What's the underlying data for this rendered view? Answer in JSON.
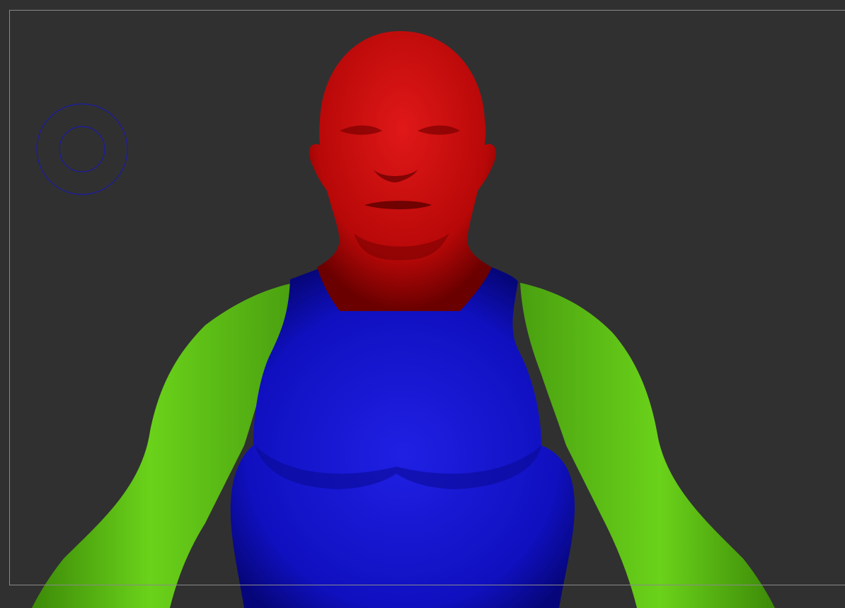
{
  "app": {
    "window_title": ""
  },
  "viewport": {
    "background_color": "#303030",
    "frame_color": "#8a8a8a"
  },
  "cursor": {
    "name": "brush-cursor-icon",
    "outer_ring_color": "#1a1aa8",
    "inner_ring_color": "#1a1aa8"
  },
  "model": {
    "name": "human-bust-polygroups",
    "polygroups": [
      {
        "id": "head",
        "color": "#d21010"
      },
      {
        "id": "torso",
        "color": "#1818d8"
      },
      {
        "id": "arms",
        "color": "#5cc414"
      }
    ]
  }
}
